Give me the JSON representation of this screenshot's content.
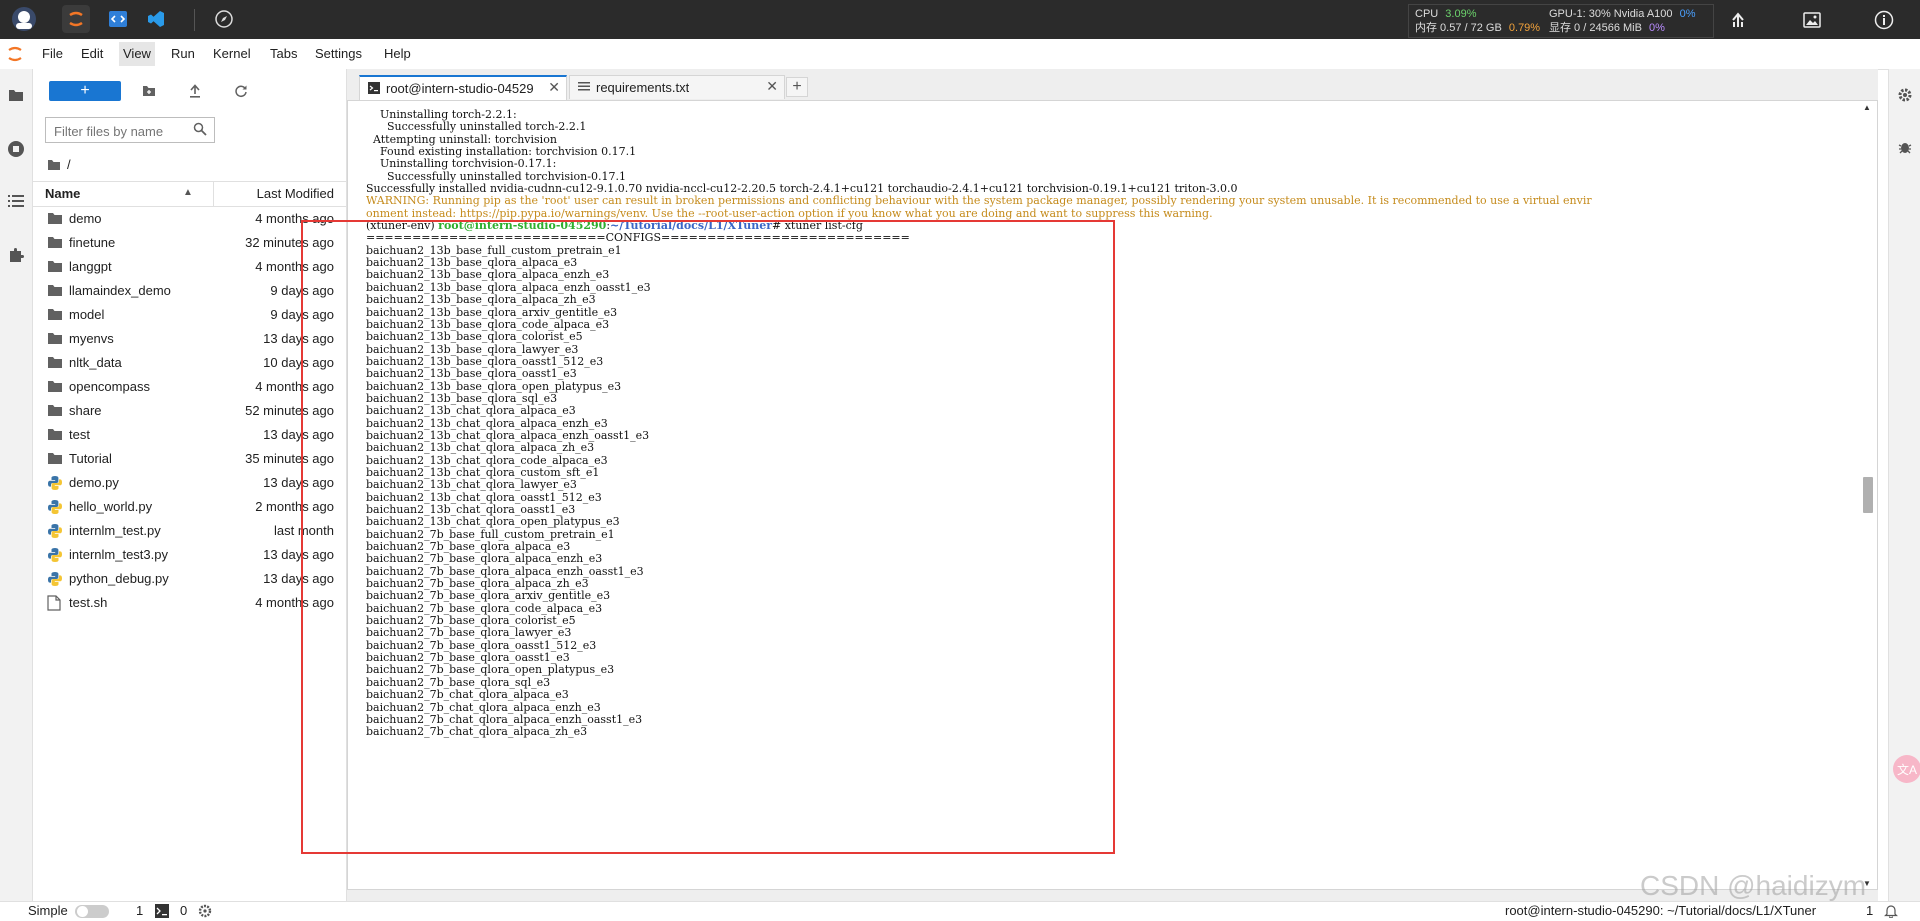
{
  "topbar": {
    "apps": [
      {
        "name": "avatar-icon"
      },
      {
        "name": "jupyter-app-icon"
      },
      {
        "name": "code-app-icon"
      },
      {
        "name": "vscode-app-icon"
      },
      {
        "name": "compass-icon"
      }
    ],
    "sysinfo": {
      "cpu_label": "CPU",
      "cpu_value": "3.09%",
      "gpu_label": "GPU-1: 30% Nvidia A100",
      "gpu_value": "0%",
      "mem_label": "内存 0.57 / 72 GB",
      "mem_value": "0.79%",
      "vram_label": "显存 0 / 24566 MiB",
      "vram_value": "0%"
    },
    "right_icons": [
      "upload-arrow-icon",
      "image-icon",
      "info-icon"
    ]
  },
  "menubar": {
    "items": [
      "File",
      "Edit",
      "View",
      "Run",
      "Kernel",
      "Tabs",
      "Settings",
      "Help"
    ],
    "active": "View"
  },
  "filebrowser": {
    "search_placeholder": "Filter files by name",
    "breadcrumb": "/",
    "col_name": "Name",
    "col_modified": "Last Modified",
    "files": [
      {
        "name": "demo",
        "type": "folder",
        "modified": "4 months ago"
      },
      {
        "name": "finetune",
        "type": "folder",
        "modified": "32 minutes ago"
      },
      {
        "name": "langgpt",
        "type": "folder",
        "modified": "4 months ago"
      },
      {
        "name": "llamaindex_demo",
        "type": "folder",
        "modified": "9 days ago"
      },
      {
        "name": "model",
        "type": "folder",
        "modified": "9 days ago"
      },
      {
        "name": "myenvs",
        "type": "folder",
        "modified": "13 days ago"
      },
      {
        "name": "nltk_data",
        "type": "folder",
        "modified": "10 days ago"
      },
      {
        "name": "opencompass",
        "type": "folder",
        "modified": "4 months ago"
      },
      {
        "name": "share",
        "type": "folder",
        "modified": "52 minutes ago"
      },
      {
        "name": "test",
        "type": "folder",
        "modified": "13 days ago"
      },
      {
        "name": "Tutorial",
        "type": "folder",
        "modified": "35 minutes ago"
      },
      {
        "name": "demo.py",
        "type": "python",
        "modified": "13 days ago"
      },
      {
        "name": "hello_world.py",
        "type": "python",
        "modified": "2 months ago"
      },
      {
        "name": "internlm_test.py",
        "type": "python",
        "modified": "last month"
      },
      {
        "name": "internlm_test3.py",
        "type": "python",
        "modified": "13 days ago"
      },
      {
        "name": "python_debug.py",
        "type": "python",
        "modified": "13 days ago"
      },
      {
        "name": "test.sh",
        "type": "file",
        "modified": "4 months ago"
      }
    ]
  },
  "tabs": [
    {
      "label": "root@intern-studio-04529",
      "icon": "terminal-icon",
      "active": true
    },
    {
      "label": "requirements.txt",
      "icon": "text-file-icon",
      "active": false
    }
  ],
  "terminal": {
    "header_lines": [
      "    Uninstalling torch-2.2.1:",
      "      Successfully uninstalled torch-2.2.1",
      "  Attempting uninstall: torchvision",
      "    Found existing installation: torchvision 0.17.1",
      "    Uninstalling torchvision-0.17.1:",
      "      Successfully uninstalled torchvision-0.17.1",
      "Successfully installed nvidia-cudnn-cu12-9.1.0.70 nvidia-nccl-cu12-2.20.5 torch-2.4.1+cu121 torchaudio-2.4.1+cu121 torchvision-0.19.1+cu121 triton-3.0.0"
    ],
    "warning_lines": [
      "WARNING: Running pip as the 'root' user can result in broken permissions and conflicting behaviour with the system package manager, possibly rendering your system unusable. It is recommended to use a virtual envir",
      "onment instead: https://pip.pypa.io/warnings/venv. Use the --root-user-action option if you know what you are doing and want to suppress this warning."
    ],
    "prompt_env": "(xtuner-env) ",
    "prompt_user": "root@intern-studio-045290",
    "prompt_sep": ":",
    "prompt_path": "~/Tutorial/docs/L1/XTuner",
    "prompt_cmd": "# xtuner list-cfg",
    "configs_header": "==========================CONFIGS===========================",
    "configs": [
      "baichuan2_13b_base_full_custom_pretrain_e1",
      "baichuan2_13b_base_qlora_alpaca_e3",
      "baichuan2_13b_base_qlora_alpaca_enzh_e3",
      "baichuan2_13b_base_qlora_alpaca_enzh_oasst1_e3",
      "baichuan2_13b_base_qlora_alpaca_zh_e3",
      "baichuan2_13b_base_qlora_arxiv_gentitle_e3",
      "baichuan2_13b_base_qlora_code_alpaca_e3",
      "baichuan2_13b_base_qlora_colorist_e5",
      "baichuan2_13b_base_qlora_lawyer_e3",
      "baichuan2_13b_base_qlora_oasst1_512_e3",
      "baichuan2_13b_base_qlora_oasst1_e3",
      "baichuan2_13b_base_qlora_open_platypus_e3",
      "baichuan2_13b_base_qlora_sql_e3",
      "baichuan2_13b_chat_qlora_alpaca_e3",
      "baichuan2_13b_chat_qlora_alpaca_enzh_e3",
      "baichuan2_13b_chat_qlora_alpaca_enzh_oasst1_e3",
      "baichuan2_13b_chat_qlora_alpaca_zh_e3",
      "baichuan2_13b_chat_qlora_code_alpaca_e3",
      "baichuan2_13b_chat_qlora_custom_sft_e1",
      "baichuan2_13b_chat_qlora_lawyer_e3",
      "baichuan2_13b_chat_qlora_oasst1_512_e3",
      "baichuan2_13b_chat_qlora_oasst1_e3",
      "baichuan2_13b_chat_qlora_open_platypus_e3",
      "baichuan2_7b_base_full_custom_pretrain_e1",
      "baichuan2_7b_base_qlora_alpaca_e3",
      "baichuan2_7b_base_qlora_alpaca_enzh_e3",
      "baichuan2_7b_base_qlora_alpaca_enzh_oasst1_e3",
      "baichuan2_7b_base_qlora_alpaca_zh_e3",
      "baichuan2_7b_base_qlora_arxiv_gentitle_e3",
      "baichuan2_7b_base_qlora_code_alpaca_e3",
      "baichuan2_7b_base_qlora_colorist_e5",
      "baichuan2_7b_base_qlora_lawyer_e3",
      "baichuan2_7b_base_qlora_oasst1_512_e3",
      "baichuan2_7b_base_qlora_oasst1_e3",
      "baichuan2_7b_base_qlora_open_platypus_e3",
      "baichuan2_7b_base_qlora_sql_e3",
      "baichuan2_7b_chat_qlora_alpaca_e3",
      "baichuan2_7b_chat_qlora_alpaca_enzh_e3",
      "baichuan2_7b_chat_qlora_alpaca_enzh_oasst1_e3",
      "baichuan2_7b_chat_qlora_alpaca_zh_e3"
    ]
  },
  "statusbar": {
    "mode_label": "Simple",
    "kernels_count": "1",
    "terminals_count": "0",
    "current_path": "root@intern-studio-045290: ~/Tutorial/docs/L1/XTuner",
    "right_count": "1"
  },
  "watermark": "CSDN @haidizym",
  "colors": {
    "accent": "#1976d2",
    "highlight_box": "#e53935",
    "warning_text": "#c58b1c",
    "prompt_user": "#2eae2e",
    "prompt_path": "#3a66c6"
  }
}
